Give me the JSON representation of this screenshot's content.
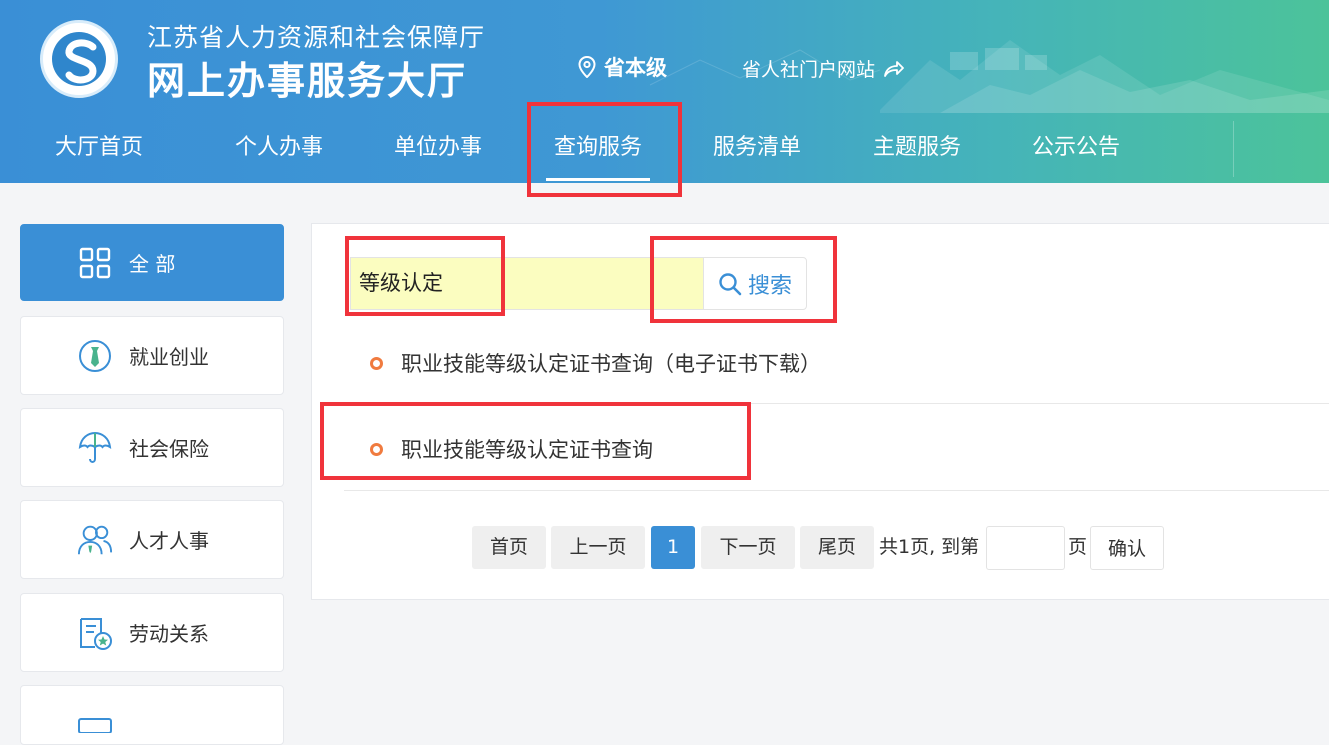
{
  "header": {
    "org_name": "江苏省人力资源和社会保障厅",
    "hall_name": "网上办事服务大厅",
    "location": "省本级",
    "portal_link": "省人社门户网站"
  },
  "nav": {
    "items": [
      {
        "label": "大厅首页"
      },
      {
        "label": "个人办事"
      },
      {
        "label": "单位办事"
      },
      {
        "label": "查询服务"
      },
      {
        "label": "服务清单"
      },
      {
        "label": "主题服务"
      },
      {
        "label": "公示公告"
      }
    ],
    "active": "查询服务"
  },
  "sidebar": {
    "items": [
      {
        "label": "全 部",
        "icon": "grid-icon"
      },
      {
        "label": "就业创业",
        "icon": "tie-icon"
      },
      {
        "label": "社会保险",
        "icon": "umbrella-icon"
      },
      {
        "label": "人才人事",
        "icon": "people-icon"
      },
      {
        "label": "劳动关系",
        "icon": "document-badge-icon"
      }
    ]
  },
  "search": {
    "value": "等级认定",
    "button_label": "搜索"
  },
  "results": [
    {
      "title": "职业技能等级认定证书查询（电子证书下载）"
    },
    {
      "title": "职业技能等级认定证书查询"
    }
  ],
  "pagination": {
    "first": "首页",
    "prev": "上一页",
    "current": "1",
    "next": "下一页",
    "last": "尾页",
    "summary": "共1页, 到第",
    "page_suffix": "页",
    "confirm": "确认"
  },
  "colors": {
    "primary": "#3a8fd6",
    "header_end": "#4cc39a",
    "highlight": "#f0333b",
    "search_bg": "#fbfdc0",
    "bullet": "#f07b3f"
  }
}
